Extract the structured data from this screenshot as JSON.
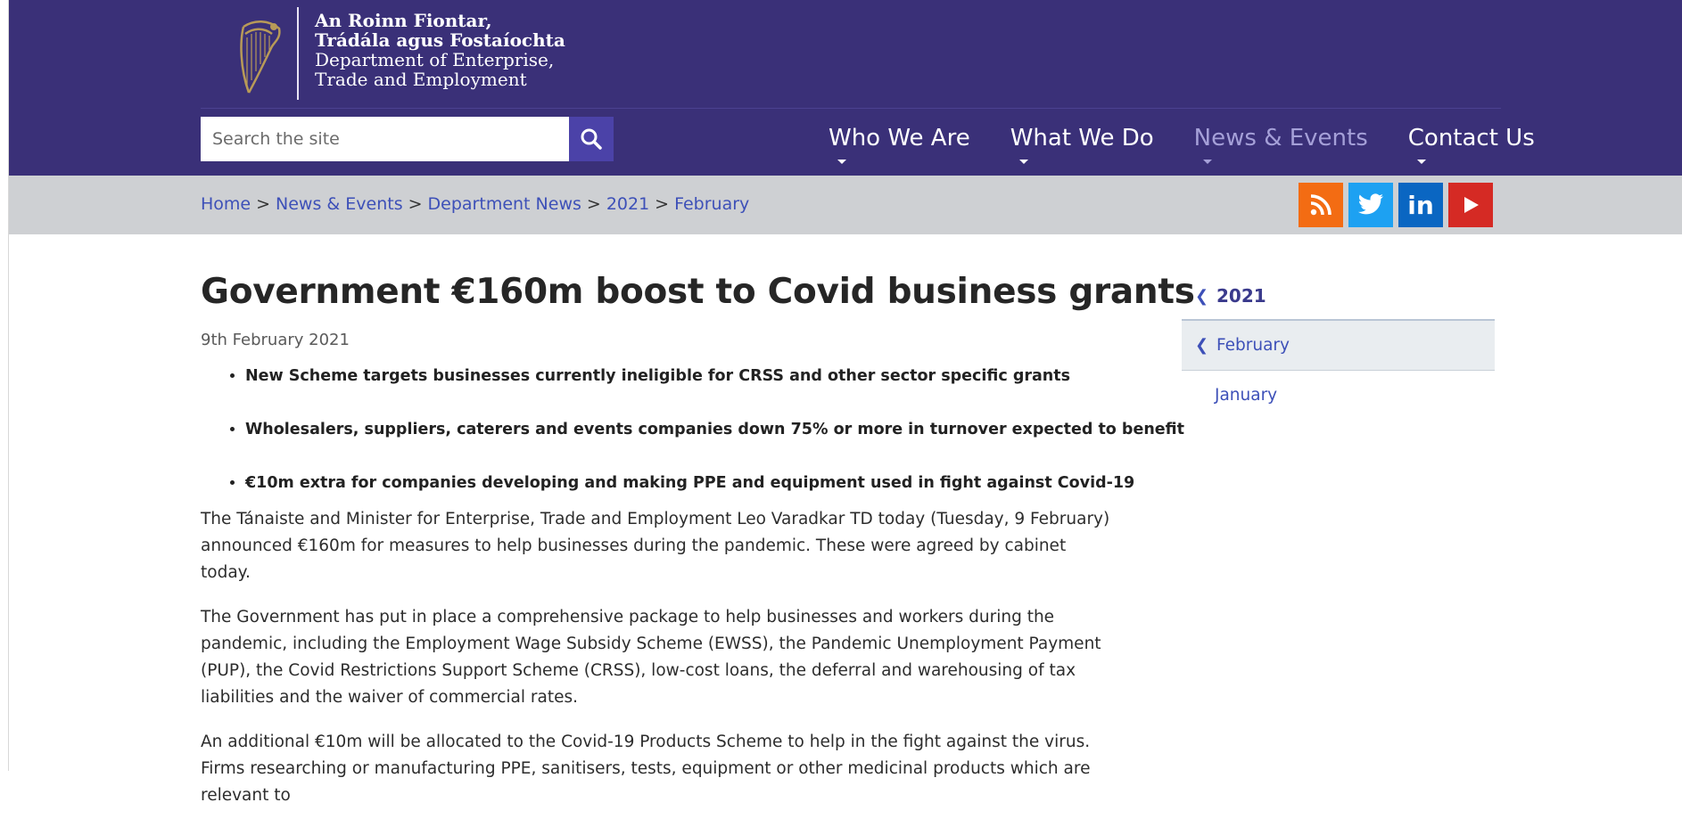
{
  "header": {
    "logo_lines": [
      "An Roinn Fiontar,",
      "Trádála agus Fostaíochta",
      "Department of Enterprise,",
      "Trade and Employment"
    ],
    "logo_icon": "harp-emblem-icon",
    "search": {
      "placeholder": "Search the site",
      "icon": "search-icon"
    },
    "nav": [
      {
        "label": "Who We Are",
        "active": false
      },
      {
        "label": "What We Do",
        "active": false
      },
      {
        "label": "News & Events",
        "active": true
      },
      {
        "label": "Contact Us",
        "active": false
      }
    ]
  },
  "breadcrumb": {
    "items": [
      "Home",
      "News & Events",
      "Department News",
      "2021",
      "February"
    ],
    "separator": ">"
  },
  "social": [
    {
      "icon": "rss-icon",
      "color": "#f36c13"
    },
    {
      "icon": "twitter-icon",
      "color": "#1da1f2"
    },
    {
      "icon": "linkedin-icon",
      "color": "#0a66c2",
      "glyph": "in"
    },
    {
      "icon": "youtube-icon",
      "color": "#d52a24"
    }
  ],
  "article": {
    "title": "Government €160m boost to Covid business grants",
    "date": "9th February 2021",
    "bullets": [
      "New Scheme targets businesses currently ineligible for CRSS and other sector specific grants",
      "Wholesalers, suppliers, caterers and events companies down 75% or more in turnover expected to benefit",
      "€10m extra for companies developing and making PPE and equipment used in fight against Covid-19"
    ],
    "paragraphs": [
      "The Tánaiste and Minister for Enterprise, Trade and Employment Leo Varadkar TD today (Tuesday, 9 February) announced €160m for measures to help businesses during the pandemic. These were agreed by cabinet today.",
      "The Government has put in place a comprehensive package to help businesses and workers during the pandemic, including the Employment Wage Subsidy Scheme (EWSS), the Pandemic Unemployment Payment (PUP), the Covid Restrictions Support Scheme (CRSS), low-cost loans, the deferral and warehousing of tax liabilities and the waiver of commercial rates.",
      "An additional €10m will be allocated to the Covid-19 Products Scheme to help in the fight against the virus. Firms researching or manufacturing PPE, sanitisers, tests, equipment or other medicinal products which are relevant to"
    ]
  },
  "sidebar": {
    "year": "2021",
    "current_month": "February",
    "other_months": [
      "January"
    ]
  },
  "colors": {
    "header_bg": "#3a3078",
    "crumb_bg": "#ced0d3",
    "link": "#3d50b8",
    "nav_active": "#a5a0d8"
  }
}
